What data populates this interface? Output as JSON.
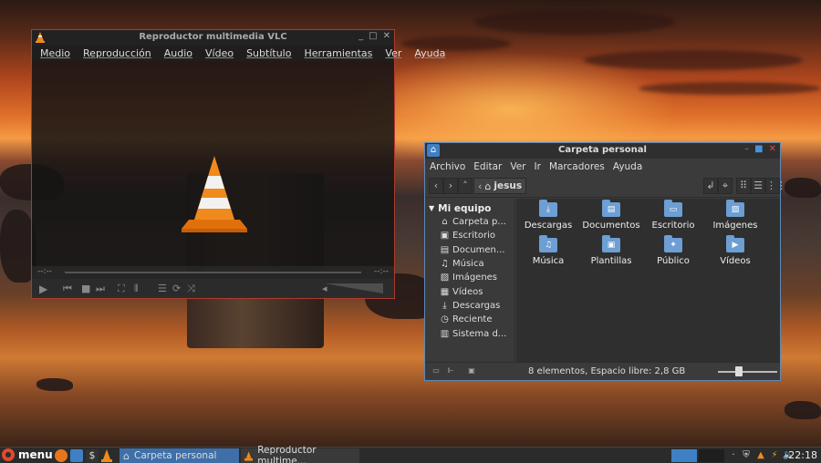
{
  "vlc": {
    "title": "Reproductor multimedia VLC",
    "menu": [
      "Medio",
      "Reproducción",
      "Audio",
      "Vídeo",
      "Subtítulo",
      "Herramientas",
      "Ver",
      "Ayuda"
    ],
    "time_elapsed": "--:--",
    "time_total": "--:--"
  },
  "filemanager": {
    "title": "Carpeta personal",
    "menu": [
      "Archivo",
      "Editar",
      "Ver",
      "Ir",
      "Marcadores",
      "Ayuda"
    ],
    "breadcrumb": "jesus",
    "sidebar": {
      "header": "Mi equipo",
      "items": [
        {
          "label": "Carpeta p...",
          "icon": "home-icon"
        },
        {
          "label": "Escritorio",
          "icon": "desktop-icon"
        },
        {
          "label": "Documen...",
          "icon": "document-icon"
        },
        {
          "label": "Música",
          "icon": "music-icon"
        },
        {
          "label": "Imágenes",
          "icon": "image-icon"
        },
        {
          "label": "Vídeos",
          "icon": "video-icon"
        },
        {
          "label": "Descargas",
          "icon": "download-icon"
        },
        {
          "label": "Reciente",
          "icon": "clock-icon"
        },
        {
          "label": "Sistema d...",
          "icon": "drive-icon"
        }
      ]
    },
    "files": [
      {
        "name": "Descargas",
        "icon": "download-folder-icon"
      },
      {
        "name": "Documentos",
        "icon": "documents-folder-icon"
      },
      {
        "name": "Escritorio",
        "icon": "desktop-folder-icon"
      },
      {
        "name": "Imágenes",
        "icon": "pictures-folder-icon"
      },
      {
        "name": "Música",
        "icon": "music-folder-icon"
      },
      {
        "name": "Plantillas",
        "icon": "templates-folder-icon"
      },
      {
        "name": "Público",
        "icon": "public-folder-icon"
      },
      {
        "name": "Vídeos",
        "icon": "videos-folder-icon"
      }
    ],
    "status": "8 elementos, Espacio libre: 2,8 GB",
    "zoom_level": 0.35
  },
  "taskbar": {
    "menu_label": "menu",
    "tasks": [
      {
        "label": "Carpeta personal",
        "active": true
      },
      {
        "label": "Reproductor multime...",
        "active": false
      }
    ],
    "clock": "22:18"
  },
  "colors": {
    "accent": "#3f6fa8",
    "vlc_orange": "#f08a1c",
    "folder_blue": "#6d9ed4"
  }
}
